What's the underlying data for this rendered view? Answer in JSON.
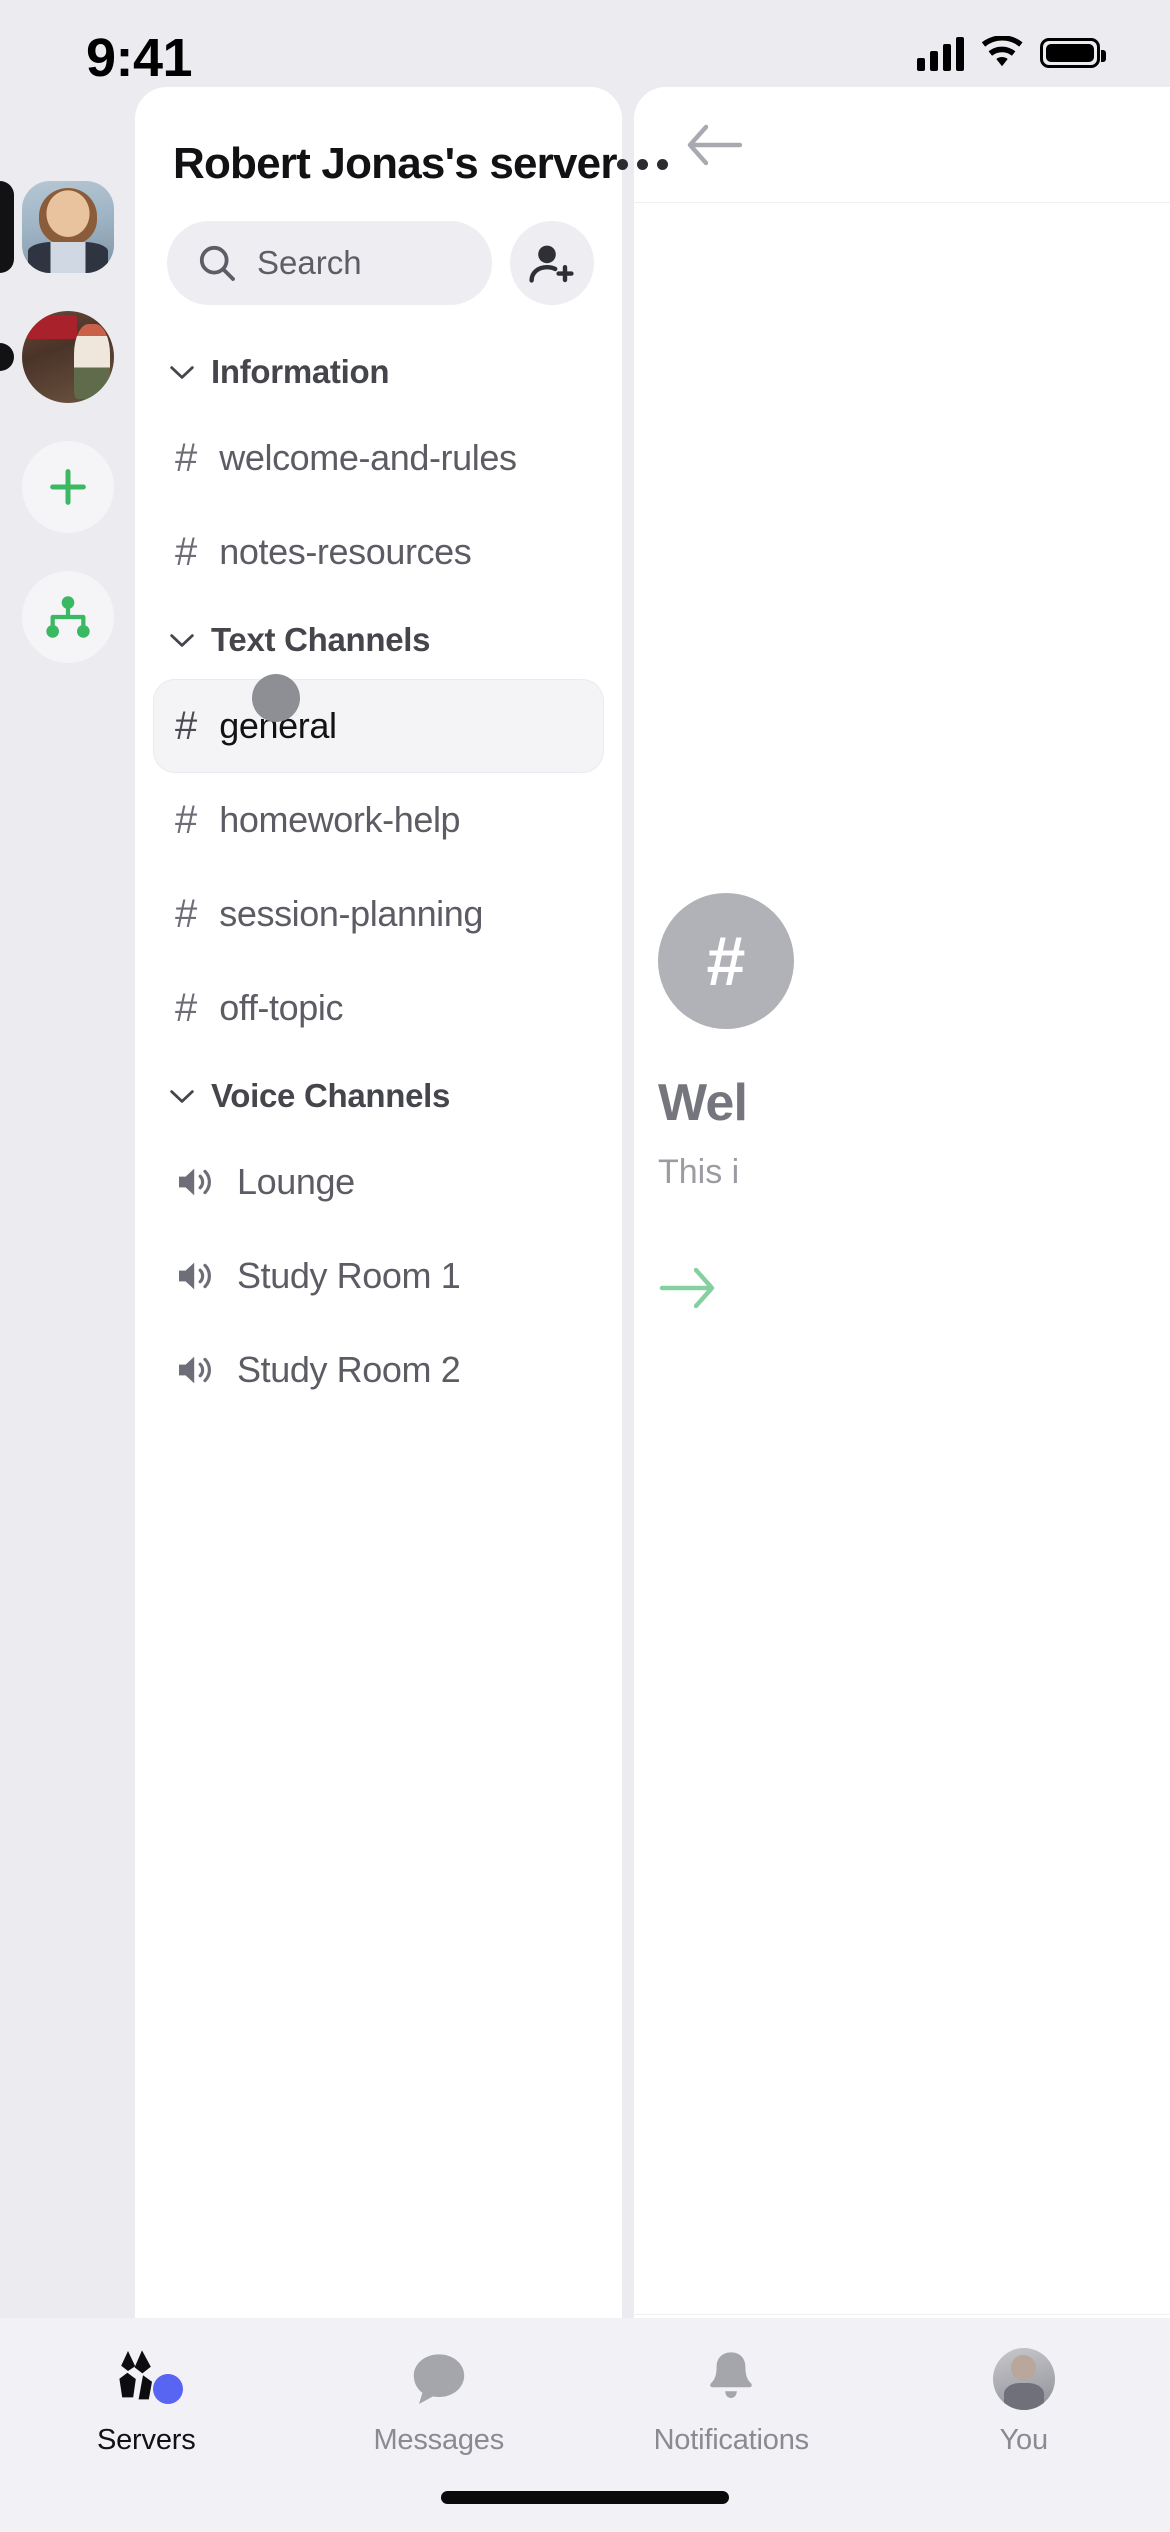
{
  "status_bar": {
    "time": "9:41",
    "signal_icon": "cellular-bars-icon",
    "wifi_icon": "wifi-icon",
    "battery_icon": "battery-full-icon"
  },
  "server_rail": {
    "items": [
      {
        "name": "server-avatar-1",
        "state": "selected",
        "icon": "user-photo-avatar"
      },
      {
        "name": "server-avatar-2",
        "state": "unread",
        "icon": "user-photo-avatar"
      },
      {
        "name": "add-server-button",
        "state": "action",
        "icon": "plus-icon"
      },
      {
        "name": "explore-servers-button",
        "state": "action",
        "icon": "hierarchy-tree-icon"
      }
    ],
    "accent_green": "#3ab862",
    "pill_color": "#121214"
  },
  "panel": {
    "server_title": "Robert Jonas's server",
    "more_button_label": "•••",
    "search": {
      "placeholder": "Search",
      "icon": "search-icon"
    },
    "invite_button": {
      "label": "Invite member",
      "icon": "add-person-icon"
    },
    "categories": [
      {
        "label": "Information",
        "collapse_icon": "chevron-down-icon",
        "channels": [
          {
            "name": "welcome-and-rules",
            "type": "text",
            "icon": "hash-icon",
            "selected": false
          },
          {
            "name": "notes-resources",
            "type": "text",
            "icon": "hash-icon",
            "selected": false
          }
        ]
      },
      {
        "label": "Text Channels",
        "collapse_icon": "chevron-down-icon",
        "channels": [
          {
            "name": "general",
            "type": "text",
            "icon": "hash-icon",
            "selected": true
          },
          {
            "name": "homework-help",
            "type": "text",
            "icon": "hash-icon",
            "selected": false
          },
          {
            "name": "session-planning",
            "type": "text",
            "icon": "hash-icon",
            "selected": false
          },
          {
            "name": "off-topic",
            "type": "text",
            "icon": "hash-icon",
            "selected": false
          }
        ]
      },
      {
        "label": "Voice Channels",
        "collapse_icon": "chevron-down-icon",
        "channels": [
          {
            "name": "Lounge",
            "type": "voice",
            "icon": "speaker-icon",
            "selected": false
          },
          {
            "name": "Study Room 1",
            "type": "voice",
            "icon": "speaker-icon",
            "selected": false
          },
          {
            "name": "Study Room 2",
            "type": "voice",
            "icon": "speaker-icon",
            "selected": false
          }
        ]
      }
    ]
  },
  "peek_panel": {
    "back_icon": "back-arrow-icon",
    "channel_icon": "hash-icon",
    "channel_glyph": "#",
    "title": "Wel",
    "subtitle": "This i",
    "forward_icon": "arrow-right-icon",
    "forward_color": "#86cfa0"
  },
  "cursor": {
    "name": "touch-cursor",
    "color": "#8e8e95"
  },
  "tab_bar": {
    "active_index": 0,
    "badge_color": "#5865f2",
    "tabs": [
      {
        "label": "Servers",
        "icon": "servers-icon",
        "active": true,
        "badge": true
      },
      {
        "label": "Messages",
        "icon": "message-bubble-icon",
        "active": false,
        "badge": false
      },
      {
        "label": "Notifications",
        "icon": "bell-icon",
        "active": false,
        "badge": false
      },
      {
        "label": "You",
        "icon": "profile-avatar-icon",
        "active": false,
        "badge": false
      }
    ]
  }
}
